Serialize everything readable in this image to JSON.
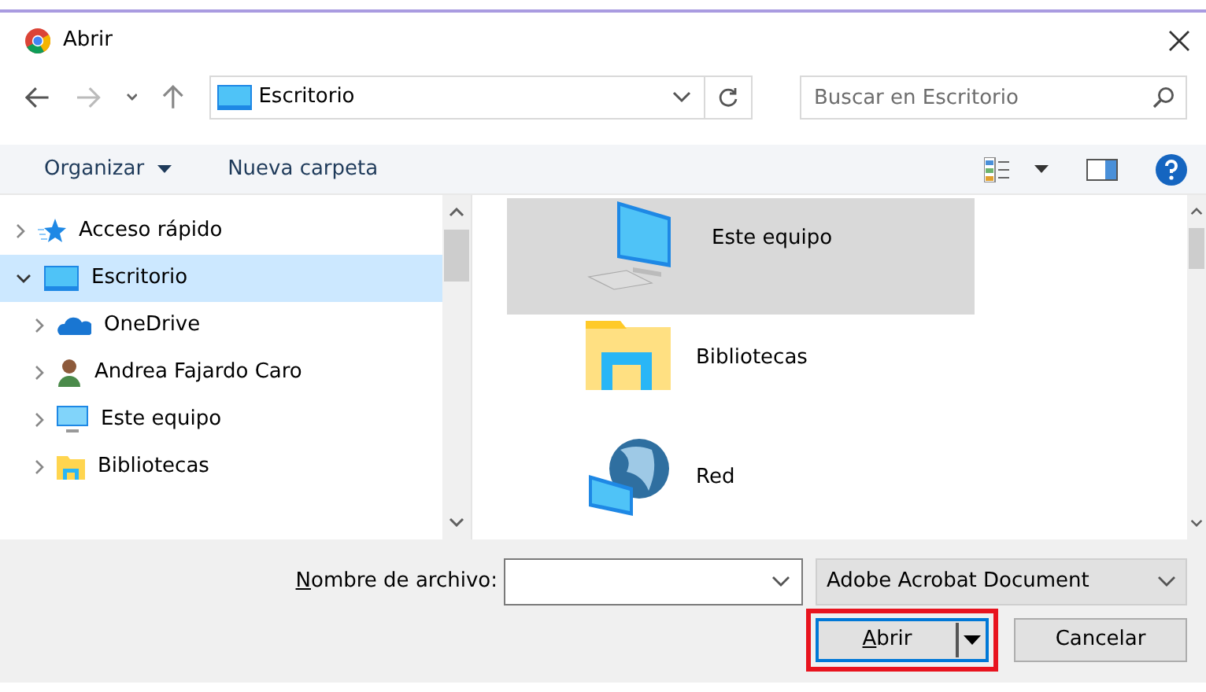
{
  "window": {
    "title": "Abrir"
  },
  "address": {
    "path": "Escritorio"
  },
  "search": {
    "placeholder": "Buscar en Escritorio"
  },
  "toolbar": {
    "items": [
      {
        "label": "Organizar",
        "has_menu": true
      },
      {
        "label": "Nueva carpeta",
        "has_menu": false
      }
    ]
  },
  "tree": [
    {
      "label": "Acceso rápido",
      "expanded": false,
      "selected": false
    },
    {
      "label": "Escritorio",
      "expanded": true,
      "selected": true,
      "children": [
        {
          "label": "OneDrive",
          "expanded": false,
          "selected": false
        },
        {
          "label": "Andrea Fajardo Caro",
          "expanded": false,
          "selected": false
        },
        {
          "label": "Este equipo",
          "expanded": false,
          "selected": false
        },
        {
          "label": "Bibliotecas",
          "expanded": false,
          "selected": false
        }
      ]
    }
  ],
  "items": [
    {
      "label": "Este equipo",
      "selected": true
    },
    {
      "label": "Bibliotecas",
      "selected": false
    },
    {
      "label": "Red",
      "selected": false
    }
  ],
  "filename": {
    "label": "Nombre de archivo:"
  },
  "filetype": {
    "value": "Adobe Acrobat Document"
  },
  "buttons": [
    {
      "label": "Abrir",
      "kind": "split",
      "highlighted": true
    },
    {
      "label": "Cancelar",
      "kind": "plain",
      "highlighted": false
    }
  ]
}
